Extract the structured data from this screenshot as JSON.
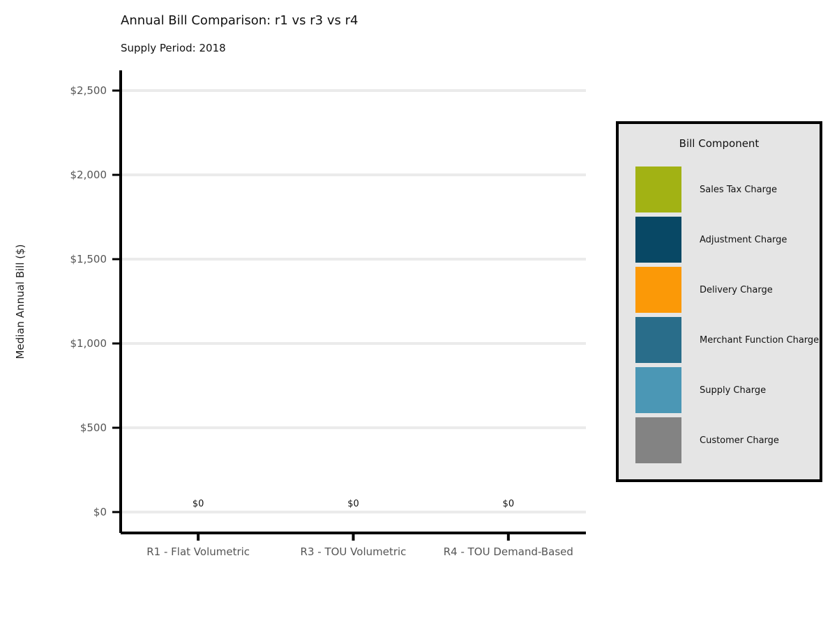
{
  "chart_data": {
    "type": "bar",
    "stacked": true,
    "title": "Annual Bill Comparison: r1 vs r3 vs r4",
    "subtitle": "Supply Period: 2018",
    "ylabel": "Median Annual Bill ($)",
    "xlabel": "",
    "ylim": [
      0,
      2500
    ],
    "yticks": [
      0,
      500,
      1000,
      1500,
      2000,
      2500
    ],
    "ytick_labels": [
      "$0",
      "$500",
      "$1,000",
      "$1,500",
      "$2,000",
      "$2,500"
    ],
    "grid": true,
    "categories": [
      "R1 - Flat Volumetric",
      "R3 - TOU Volumetric",
      "R4 - TOU Demand-Based"
    ],
    "totals": [
      0,
      0,
      0
    ],
    "total_labels": [
      "$0",
      "$0",
      "$0"
    ],
    "legend_title": "Bill Component",
    "legend_position": "right",
    "series": [
      {
        "name": "Sales Tax Charge",
        "color": "#a2b214",
        "values": [
          0,
          0,
          0
        ]
      },
      {
        "name": "Adjustment Charge",
        "color": "#084865",
        "values": [
          0,
          0,
          0
        ]
      },
      {
        "name": "Delivery Charge",
        "color": "#fb9907",
        "values": [
          0,
          0,
          0
        ]
      },
      {
        "name": "Merchant Function Charge",
        "color": "#296d8a",
        "values": [
          0,
          0,
          0
        ]
      },
      {
        "name": "Supply Charge",
        "color": "#4b97b5",
        "values": [
          0,
          0,
          0
        ]
      },
      {
        "name": "Customer Charge",
        "color": "#838383",
        "values": [
          0,
          0,
          0
        ]
      }
    ]
  }
}
